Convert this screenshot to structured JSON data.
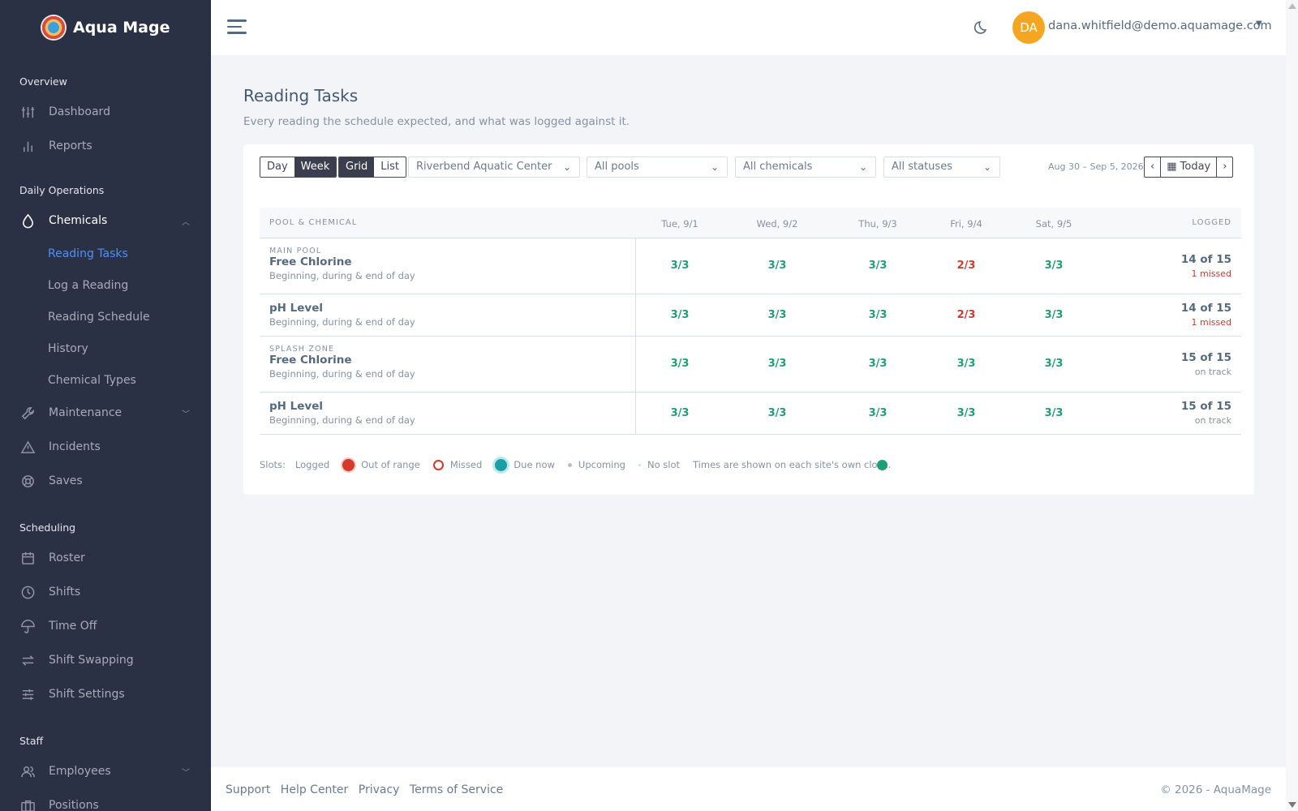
{
  "app": {
    "name": "Aqua Mage"
  },
  "sidebar": {
    "sections": {
      "overview": "Overview",
      "daily": "Daily Operations",
      "scheduling": "Scheduling",
      "staff": "Staff"
    },
    "items": {
      "dashboard": "Dashboard",
      "reports": "Reports",
      "chemicals": "Chemicals",
      "reading_tasks": "Reading Tasks",
      "log_reading": "Log a Reading",
      "reading_schedule": "Reading Schedule",
      "history": "History",
      "chemical_types": "Chemical Types",
      "maintenance": "Maintenance",
      "incidents": "Incidents",
      "saves": "Saves",
      "roster": "Roster",
      "shifts": "Shifts",
      "time_off": "Time Off",
      "shift_swapping": "Shift Swapping",
      "shift_settings": "Shift Settings",
      "employees": "Employees",
      "positions": "Positions"
    }
  },
  "header": {
    "avatar_initials": "DA",
    "user_email": "dana.whitfield@demo.aquamage.com"
  },
  "page": {
    "title": "Reading Tasks",
    "subtitle": "Every reading the schedule expected, and what was logged against it."
  },
  "toolbar": {
    "view_day": "Day",
    "view_week": "Week",
    "mode_grid": "Grid",
    "mode_list": "List",
    "site": "Riverbend Aquatic Center",
    "pools": "All pools",
    "chemicals": "All chemicals",
    "statuses": "All statuses",
    "date_range": "Aug 30 – Sep 5, 2026",
    "today": "Today"
  },
  "grid": {
    "col_first": "POOL & CHEMICAL",
    "days": [
      "Tue, 9/1",
      "Wed, 9/2",
      "Thu, 9/3",
      "Fri, 9/4",
      "Sat, 9/5"
    ],
    "col_logged": "LOGGED",
    "rows": [
      {
        "pool": "MAIN POOL",
        "chemical": "Free Chlorine",
        "schedule": "Beginning, during & end of day",
        "cells": [
          "3/3",
          "3/3",
          "3/3",
          "2/3",
          "3/3"
        ],
        "logged": "14 of 15",
        "status": "1 missed"
      },
      {
        "pool": "",
        "chemical": "pH Level",
        "schedule": "Beginning, during & end of day",
        "cells": [
          "3/3",
          "3/3",
          "3/3",
          "2/3",
          "3/3"
        ],
        "logged": "14 of 15",
        "status": "1 missed"
      },
      {
        "pool": "SPLASH ZONE",
        "chemical": "Free Chlorine",
        "schedule": "Beginning, during & end of day",
        "cells": [
          "3/3",
          "3/3",
          "3/3",
          "3/3",
          "3/3"
        ],
        "logged": "15 of 15",
        "status": "on track"
      },
      {
        "pool": "",
        "chemical": "pH Level",
        "schedule": "Beginning, during & end of day",
        "cells": [
          "3/3",
          "3/3",
          "3/3",
          "3/3",
          "3/3"
        ],
        "logged": "15 of 15",
        "status": "on track"
      }
    ]
  },
  "legend": {
    "label": "Slots:",
    "logged": "Logged",
    "out_of_range": "Out of range",
    "missed": "Missed",
    "due_now": "Due now",
    "upcoming": "Upcoming",
    "no_slot": "No slot",
    "note": "Times are shown on each site's own clock."
  },
  "footer": {
    "support": "Support",
    "help": "Help Center",
    "privacy": "Privacy",
    "terms": "Terms of Service",
    "copyright": "© 2026 - AquaMage"
  },
  "colors": {
    "sidebar_bg": "#2b3145",
    "accent": "#4f8ff7",
    "ok": "#1e9f74",
    "bad": "#d33a2c",
    "due": "#18a0a6",
    "avatar": "#f4a621"
  }
}
